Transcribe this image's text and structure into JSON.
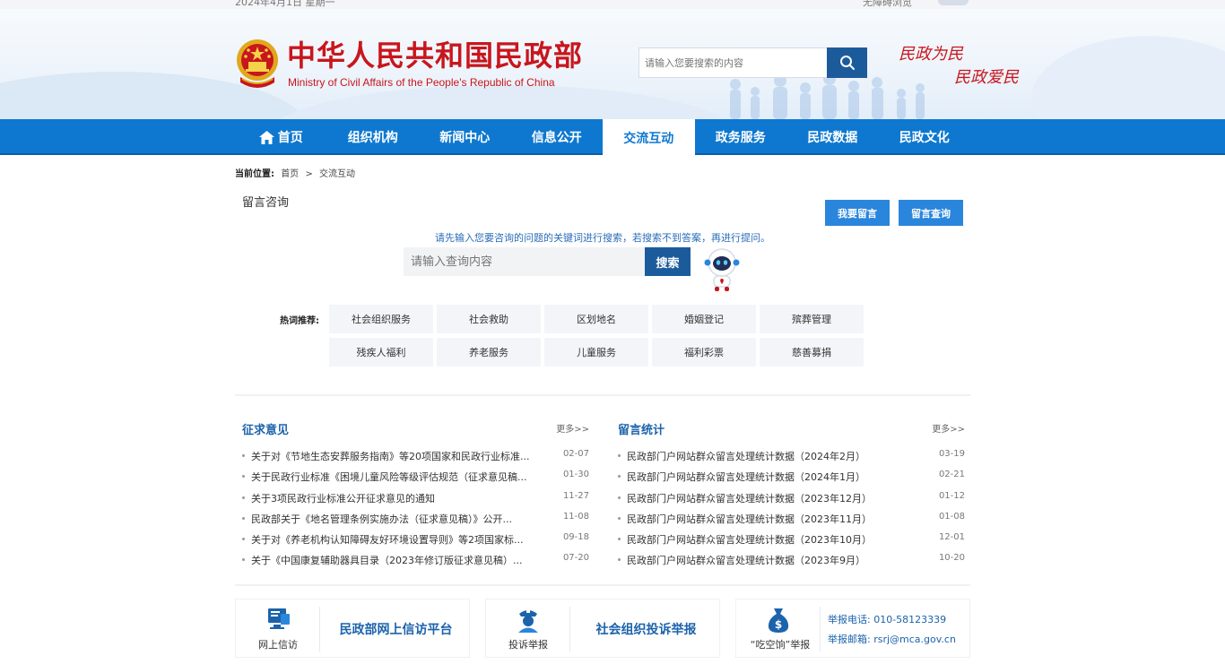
{
  "top": {
    "date": "2024年4月1日 星期一",
    "access": "无障碍浏览"
  },
  "header": {
    "brand_cn": "中华人民共和国民政部",
    "brand_en": "Ministry of Civil Affairs of the People's Republic of China",
    "search_placeholder": "请输入您要搜索的内容",
    "slogan_line1": "民政为民",
    "slogan_line2": "民政爱民"
  },
  "nav": {
    "items": [
      {
        "label": "首页"
      },
      {
        "label": "组织机构"
      },
      {
        "label": "新闻中心"
      },
      {
        "label": "信息公开"
      },
      {
        "label": "交流互动"
      },
      {
        "label": "政务服务"
      },
      {
        "label": "民政数据"
      },
      {
        "label": "民政文化"
      }
    ],
    "active": "交流互动"
  },
  "breadcrumb": {
    "label": "当前位置:",
    "home": "首页",
    "sep": ">",
    "current": "交流互动"
  },
  "consult": {
    "title": "留言咨询",
    "leave_msg": "我要留言",
    "query_msg": "留言查询",
    "tip": "请先输入您要咨询的问题的关键词进行搜索，若搜索不到答案，再进行提问。",
    "placeholder": "请输入查询内容",
    "search_btn": "搜索",
    "hot_label": "热词推荐:",
    "tags": [
      "社会组织服务",
      "社会救助",
      "区划地名",
      "婚姻登记",
      "殡葬管理",
      "残疾人福利",
      "养老服务",
      "儿童服务",
      "福利彩票",
      "慈善募捐"
    ]
  },
  "opinions": {
    "title": "征求意见",
    "more": "更多>>",
    "items": [
      {
        "t": "关于对《节地生态安葬服务指南》等20项国家和民政行业标准...",
        "d": "02-07"
      },
      {
        "t": "关于民政行业标准《困境儿童风险等级评估规范（征求意见稿...",
        "d": "01-30"
      },
      {
        "t": "关于3项民政行业标准公开征求意见的通知",
        "d": "11-27"
      },
      {
        "t": "民政部关于《地名管理条例实施办法（征求意见稿）》公开...",
        "d": "11-08"
      },
      {
        "t": "关于对《养老机构认知障碍友好环境设置导则》等2项国家标...",
        "d": "09-18"
      },
      {
        "t": "关于《中国康复辅助器具目录（2023年修订版征求意见稿）...",
        "d": "07-20"
      }
    ]
  },
  "stats": {
    "title": "留言统计",
    "more": "更多>>",
    "items": [
      {
        "t": "民政部门户网站群众留言处理统计数据（2024年2月）",
        "d": "03-19"
      },
      {
        "t": "民政部门户网站群众留言处理统计数据（2024年1月）",
        "d": "02-21"
      },
      {
        "t": "民政部门户网站群众留言处理统计数据（2023年12月）",
        "d": "01-12"
      },
      {
        "t": "民政部门户网站群众留言处理统计数据（2023年11月）",
        "d": "01-08"
      },
      {
        "t": "民政部门户网站群众留言处理统计数据（2023年10月）",
        "d": "12-01"
      },
      {
        "t": "民政部门户网站群众留言处理统计数据（2023年9月）",
        "d": "10-20"
      }
    ]
  },
  "cards": {
    "petition_label": "网上信访",
    "petition_title": "民政部网上信访平台",
    "complaint_label": "投诉举报",
    "complaint_title": "社会组织投诉举报",
    "fraud_label": "“吃空饷”举报",
    "phone": "举报电话: 010-58123339",
    "email": "举报邮箱: rsrj@mca.gov.cn"
  },
  "colors": {
    "brand_red": "#c8161d",
    "nav_blue": "#0e78d0",
    "link_blue": "#1c63ab",
    "dark_blue": "#1c5b9b"
  }
}
